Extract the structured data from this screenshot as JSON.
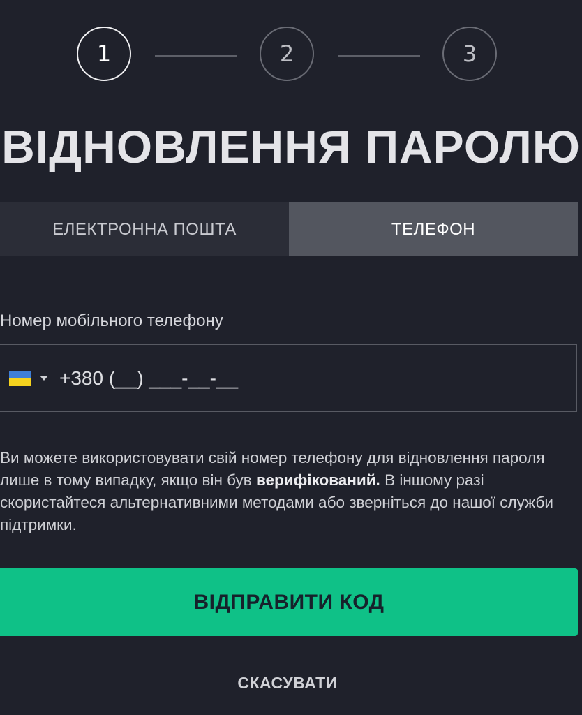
{
  "stepper": {
    "steps": [
      "1",
      "2",
      "3"
    ],
    "active_step": 1
  },
  "title": "ВІДНОВЛЕННЯ ПАРОЛЮ",
  "tabs": [
    {
      "label": "ЕЛЕКТРОННА ПОШТА",
      "selected": false
    },
    {
      "label": "ТЕЛЕФОН",
      "selected": true
    }
  ],
  "phone": {
    "label": "Номер мобільного телефону",
    "country_flag": "ukraine-flag",
    "placeholder": "+380 (__) ___-__-__",
    "value": ""
  },
  "info": {
    "text_before": "Ви можете використовувати свій номер телефону для відновлення пароля лише в тому випадку, якщо він був ",
    "text_bold": "верифікований.",
    "text_after": " В іншому разі скористайтеся альтернативними методами або зверніться до нашої служби підтримки."
  },
  "buttons": {
    "send_label": "ВІДПРАВИТИ КОД",
    "cancel_label": "СКАСУВАТИ"
  },
  "colors": {
    "background": "#1f212b",
    "accent": "#0fc187",
    "tab_selected": "#53565f",
    "tab_unselected": "#2b2d37"
  }
}
